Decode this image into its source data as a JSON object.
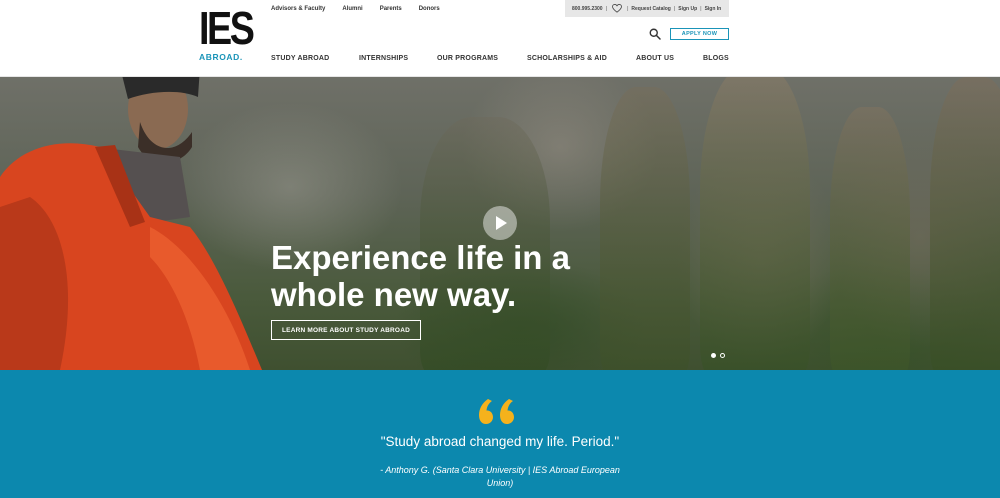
{
  "logo": {
    "main": "IES",
    "sub": "ABROAD."
  },
  "utility_links": [
    "Advisors & Faculty",
    "Alumni",
    "Parents",
    "Donors"
  ],
  "util_bar": {
    "phone": "800.995.2300",
    "request_catalog": "Request Catalog",
    "sign_up": "Sign Up",
    "sign_in": "Sign In",
    "separator": "|"
  },
  "apply_button": "APPLY NOW",
  "nav": [
    "STUDY ABROAD",
    "INTERNSHIPS",
    "OUR PROGRAMS",
    "SCHOLARSHIPS & AID",
    "ABOUT US",
    "BLOGS"
  ],
  "hero": {
    "headline_line1": "Experience life in a",
    "headline_line2": "whole new way.",
    "cta": "LEARN MORE ABOUT STUDY ABROAD",
    "slides": 2,
    "active_slide": 1
  },
  "testimonial": {
    "quote": "\"Study abroad changed my life. Period.\"",
    "author_line1": "- Anthony G. (Santa Clara University | IES Abroad European",
    "author_line2": "Union)"
  },
  "colors": {
    "brand_blue": "#0c88ae",
    "accent_blue": "#1a94b8",
    "quote_icon": "#f5b21c",
    "jacket": "#d8451f"
  },
  "icons": [
    "heart-icon",
    "search-icon",
    "play-icon",
    "quote-icon"
  ]
}
